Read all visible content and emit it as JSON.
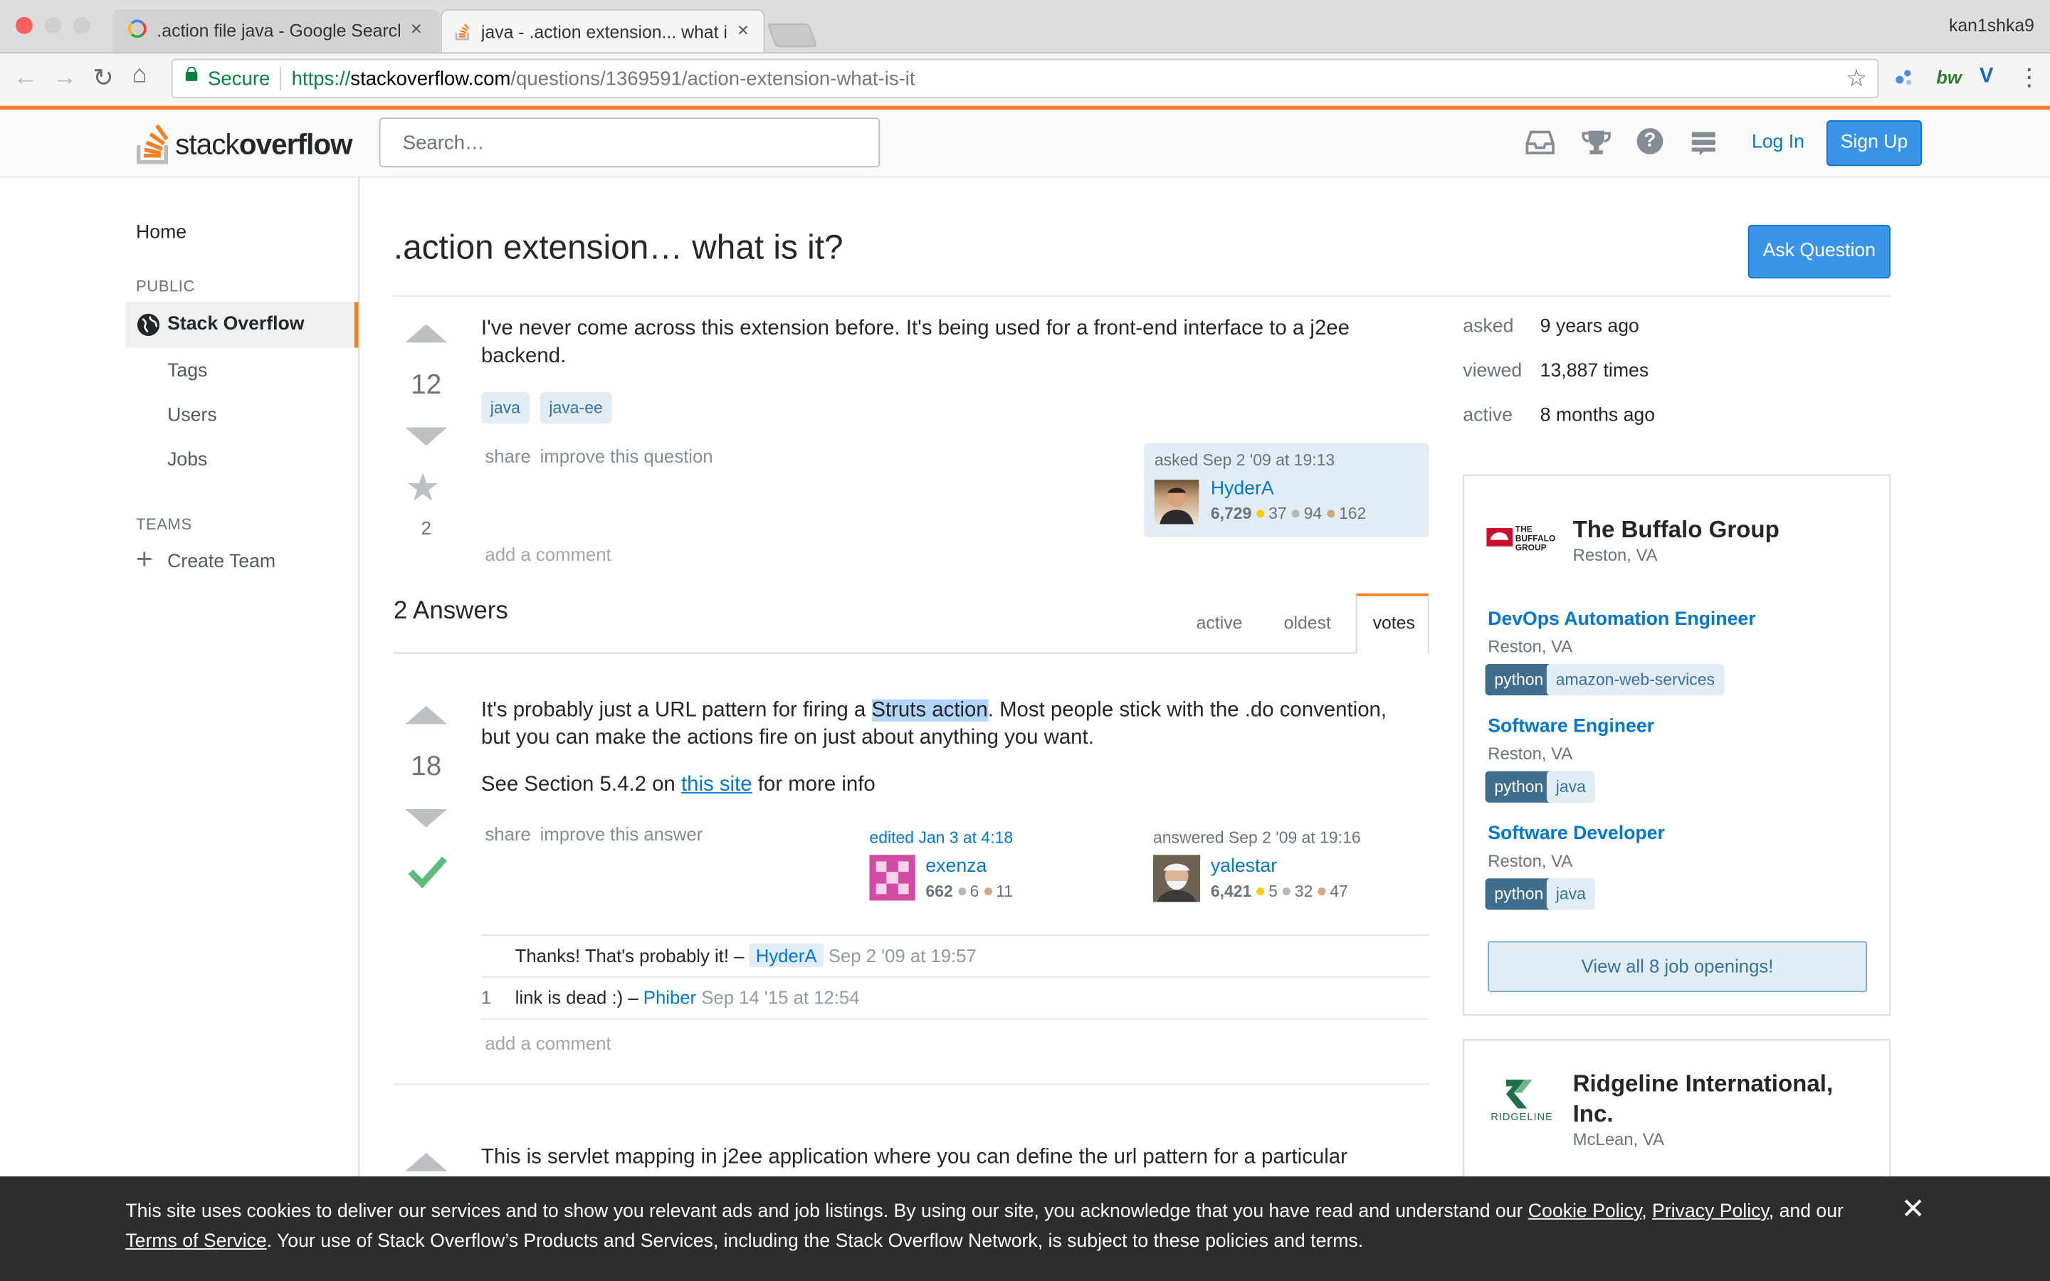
{
  "browser": {
    "tabs": [
      {
        "title": ".action file java - Google Search",
        "icon": "google-icon",
        "active": false
      },
      {
        "title": "java - .action extension... what is it?",
        "icon": "stackoverflow-icon",
        "active": true
      }
    ],
    "profile_name": "kan1shka9",
    "url": {
      "secure_label": "Secure",
      "scheme": "https://",
      "host": "stackoverflow.com",
      "path": "/questions/1369591/action-extension-what-is-it"
    }
  },
  "header": {
    "logo_stack": "stack",
    "logo_overflow": "overflow",
    "search_placeholder": "Search…",
    "login_label": "Log In",
    "signup_label": "Sign Up"
  },
  "sidebar": {
    "home": "Home",
    "public_heading": "PUBLIC",
    "stack_overflow": "Stack Overflow",
    "tags": "Tags",
    "users": "Users",
    "jobs": "Jobs",
    "teams_heading": "TEAMS",
    "create_team": "Create Team"
  },
  "question": {
    "title": ".action extension… what is it?",
    "ask_button": "Ask Question",
    "votes": "12",
    "favorites": "2",
    "body": "I've never come across this extension before. It's being used for a front-end interface to a j2ee backend.",
    "tags": [
      "java",
      "java-ee"
    ],
    "share": "share",
    "improve": "improve this question",
    "asked_label": "asked Sep 2 '09 at 19:13",
    "user": {
      "name": "HyderA",
      "rep": "6,729",
      "gold": "37",
      "silver": "94",
      "bronze": "162"
    },
    "add_comment": "add a comment"
  },
  "stats": {
    "asked_label": "asked",
    "asked_value": "9 years ago",
    "viewed_label": "viewed",
    "viewed_value": "13,887 times",
    "active_label": "active",
    "active_value": "8 months ago"
  },
  "answers": {
    "count_label": "2 Answers",
    "sort_tabs": [
      "active",
      "oldest",
      "votes"
    ],
    "first": {
      "votes": "18",
      "text_before": "It's probably just a URL pattern for firing a ",
      "highlight": "Struts action",
      "text_after": ". Most people stick with the .do convention, but you can make the actions fire on just about anything you want.",
      "line2_before": "See Section 5.4.2 on ",
      "line2_link": "this site",
      "line2_after": " for more info",
      "share": "share",
      "improve": "improve this answer",
      "edited_label": "edited Jan 3 at 4:18",
      "editor": {
        "name": "exenza",
        "rep": "662",
        "silver": "6",
        "bronze": "11"
      },
      "answered_label": "answered Sep 2 '09 at 19:16",
      "author": {
        "name": "yalestar",
        "rep": "6,421",
        "gold": "5",
        "silver": "32",
        "bronze": "47"
      },
      "comments": [
        {
          "score": "",
          "text": "Thanks! That's probably it! – ",
          "user": "HyderA",
          "time": "Sep 2 '09 at 19:57"
        },
        {
          "score": "1",
          "text": "link is dead :) – ",
          "user": "Phiber",
          "time": "Sep 14 '15 at 12:54"
        }
      ],
      "add_comment": "add a comment"
    },
    "second": {
      "text": "This is servlet mapping in j2ee application where you can define the url pattern for a particular"
    }
  },
  "jobs": {
    "company1": {
      "name": "The Buffalo Group",
      "location": "Reston, VA",
      "logo_text": "THE BUFFALO GROUP"
    },
    "listings": [
      {
        "title": "DevOps Automation Engineer",
        "location": "Reston, VA",
        "tags": [
          "python",
          "amazon-web-services"
        ]
      },
      {
        "title": "Software Engineer",
        "location": "Reston, VA",
        "tags": [
          "python",
          "java"
        ]
      },
      {
        "title": "Software Developer",
        "location": "Reston, VA",
        "tags": [
          "python",
          "java"
        ]
      }
    ],
    "view_all": "View all 8 job openings!",
    "company2": {
      "name": "Ridgeline International, Inc.",
      "location": "McLean, VA",
      "logo_text": "RIDGELINE"
    }
  },
  "cookie": {
    "text1": "This site uses cookies to deliver our services and to show you relevant ads and job listings. By using our site, you acknowledge that you have read and understand our ",
    "cookie_policy": "Cookie Policy",
    "sep1": ", ",
    "privacy_policy": "Privacy Policy",
    "sep2": ", and our ",
    "terms": "Terms of Service",
    "text2": ". Your use of Stack Overflow’s Products and Services, including the Stack Overflow Network, is subject to these policies and terms."
  },
  "colors": {
    "accent_orange": "#f48024",
    "link_blue": "#0077cc",
    "accept_green": "#5eba7d",
    "banner_dark": "#2d2d2d"
  }
}
